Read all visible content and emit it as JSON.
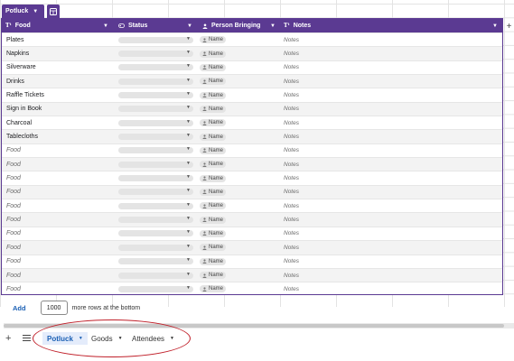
{
  "table_tab": {
    "label": "Potluck"
  },
  "columns": {
    "food": "Food",
    "status": "Status",
    "person": "Person Bringing",
    "notes": "Notes"
  },
  "rows": [
    {
      "food": "Plates",
      "placeholder": false,
      "person": "Name",
      "notes": "Notes"
    },
    {
      "food": "Napkins",
      "placeholder": false,
      "person": "Name",
      "notes": "Notes"
    },
    {
      "food": "Silverware",
      "placeholder": false,
      "person": "Name",
      "notes": "Notes"
    },
    {
      "food": "Drinks",
      "placeholder": false,
      "person": "Name",
      "notes": "Notes"
    },
    {
      "food": "Raffle Tickets",
      "placeholder": false,
      "person": "Name",
      "notes": "Notes"
    },
    {
      "food": "Sign in Book",
      "placeholder": false,
      "person": "Name",
      "notes": "Notes"
    },
    {
      "food": "Charcoal",
      "placeholder": false,
      "person": "Name",
      "notes": "Notes"
    },
    {
      "food": "Tablecloths",
      "placeholder": false,
      "person": "Name",
      "notes": "Notes"
    },
    {
      "food": "Food",
      "placeholder": true,
      "person": "Name",
      "notes": "Notes"
    },
    {
      "food": "Food",
      "placeholder": true,
      "person": "Name",
      "notes": "Notes"
    },
    {
      "food": "Food",
      "placeholder": true,
      "person": "Name",
      "notes": "Notes"
    },
    {
      "food": "Food",
      "placeholder": true,
      "person": "Name",
      "notes": "Notes"
    },
    {
      "food": "Food",
      "placeholder": true,
      "person": "Name",
      "notes": "Notes"
    },
    {
      "food": "Food",
      "placeholder": true,
      "person": "Name",
      "notes": "Notes"
    },
    {
      "food": "Food",
      "placeholder": true,
      "person": "Name",
      "notes": "Notes"
    },
    {
      "food": "Food",
      "placeholder": true,
      "person": "Name",
      "notes": "Notes"
    },
    {
      "food": "Food",
      "placeholder": true,
      "person": "Name",
      "notes": "Notes"
    },
    {
      "food": "Food",
      "placeholder": true,
      "person": "Name",
      "notes": "Notes"
    },
    {
      "food": "Food",
      "placeholder": true,
      "person": "Name",
      "notes": "Notes"
    }
  ],
  "add_rows": {
    "link": "Add",
    "count": "1000",
    "suffix": "more rows at the bottom"
  },
  "sheet_tabs": [
    {
      "label": "Potluck",
      "active": true
    },
    {
      "label": "Goods",
      "active": false
    },
    {
      "label": "Attendees",
      "active": false
    }
  ],
  "colors": {
    "header": "#5b3a92",
    "active_tab_text": "#1a5fb4",
    "annotation": "#c0202a"
  },
  "icons": {
    "text_type": "text-type-icon",
    "status": "dropdown-chip-icon",
    "person": "person-icon",
    "add_column": "plus-icon"
  }
}
